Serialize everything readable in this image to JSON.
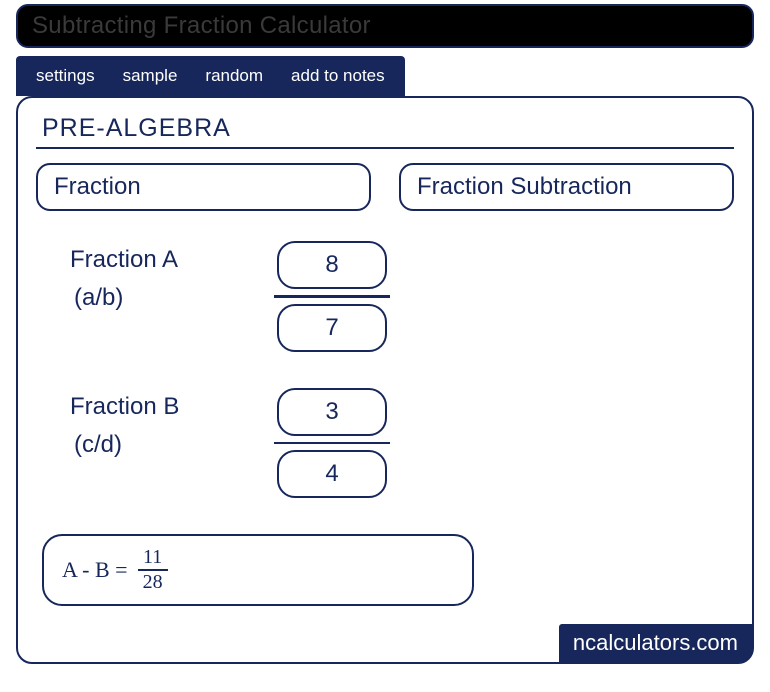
{
  "title": "Subtracting Fraction Calculator",
  "tabs": {
    "settings": "settings",
    "sample": "sample",
    "random": "random",
    "add_to_notes": "add to notes"
  },
  "section": "PRE-ALGEBRA",
  "pills": {
    "left": "Fraction",
    "right": "Fraction Subtraction"
  },
  "fractionA": {
    "label": "Fraction A",
    "sublabel": "(a/b)",
    "numerator": "8",
    "denominator": "7"
  },
  "fractionB": {
    "label": "Fraction B",
    "sublabel": "(c/d)",
    "numerator": "3",
    "denominator": "4"
  },
  "result": {
    "lhs": "A - B  =",
    "numerator": "11",
    "denominator": "28"
  },
  "brand": "ncalculators.com"
}
